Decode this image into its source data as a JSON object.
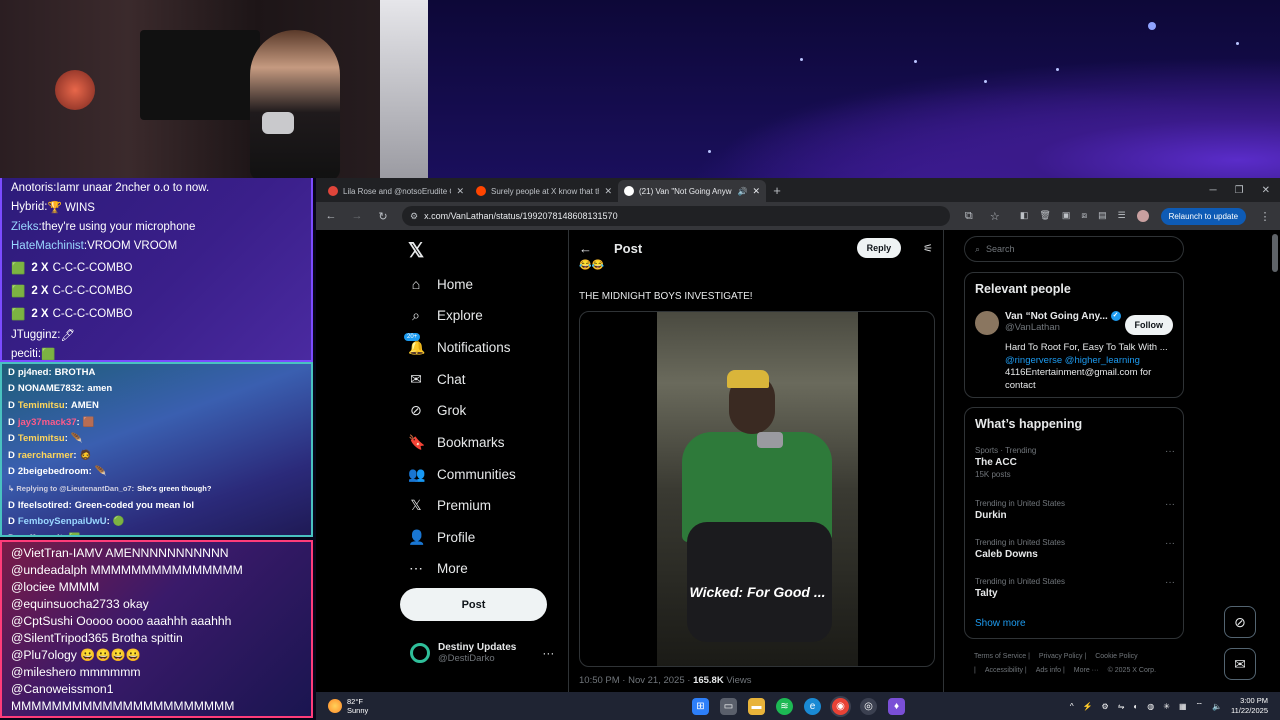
{
  "chat1": [
    {
      "user": "Anotoris",
      "msg": "Iamr unaar 2ncher o.o to now.",
      "color": "#ffffff",
      "partial": true
    },
    {
      "user": "Hybrid",
      "msg": "🏆 WINS",
      "color": "#ffffff"
    },
    {
      "user": "Zieks",
      "msg": "they're using your microphone",
      "color": "#9ad7ff"
    },
    {
      "user": "HateMachinist",
      "msg": "VROOM VROOM",
      "color": "#9ad7ff"
    },
    {
      "combo": "2 X",
      "text": "C-C-C-COMBO"
    },
    {
      "combo": "2 X",
      "text": "C-C-C-COMBO"
    },
    {
      "combo": "2 X",
      "text": "C-C-C-COMBO"
    },
    {
      "user": "JTugginz",
      "msg": "🖊",
      "color": "#ffffff"
    },
    {
      "user": "peciti",
      "msg": "🟩",
      "color": "#ffffff"
    }
  ],
  "chat2": [
    {
      "user": "pj4ned",
      "msg": "BROTHA",
      "color": "#ffffff"
    },
    {
      "user": "NONAME7832",
      "msg": "amen",
      "color": "#ffffff"
    },
    {
      "user": "Temimitsu",
      "msg": "AMEN",
      "color": "#ffd65a"
    },
    {
      "user": "jay37mack37",
      "msg": "🟫",
      "color": "#ff5a8a"
    },
    {
      "user": "Temimitsu",
      "msg": "🪶",
      "color": "#ffd65a"
    },
    {
      "user": "raercharmer",
      "msg": "🧔",
      "color": "#ffd65a"
    },
    {
      "user": "2beigebedroom",
      "msg": "🪶",
      "color": "#ffffff"
    },
    {
      "user": "↳ Replying to @LieutenantDan_o7:",
      "msg": "She's green though?",
      "color": "#d0d0e0",
      "small": true
    },
    {
      "user": "Ifeelsotired",
      "msg": "Green-coded you mean lol",
      "color": "#ffffff"
    },
    {
      "user": "FemboySenpaiUwU",
      "msg": "🟢",
      "color": "#9ad7ff"
    },
    {
      "user": "coffeespit",
      "msg": "🟩",
      "color": "#ffffff"
    }
  ],
  "chat3": [
    "@VietTran-IAMV AMENNNNNNNNNNN",
    "@undeadalph MMMMMMMMMMMMMMM",
    "@lociee MMMM",
    "@equinsuocha2733 okay",
    "@CptSushi Ooooo oooo aaahhh aaahhh",
    "@SilentTripod365 Brotha spittin",
    "@Plu7ology 😀😀😀😀",
    "@mileshero mmmmmm",
    "@Canoweissmon1",
    "MMMMMMMMMMMMMMMMMMMMMM"
  ],
  "tabs": [
    {
      "title": "Lila Rose and @notsoErudite C",
      "fav": "#e0453a"
    },
    {
      "title": "Surely people at X know that th",
      "fav": "#ff4500"
    },
    {
      "title": "(21) Van \"Not Going Anywh",
      "fav": "#ffffff",
      "active": true
    }
  ],
  "url": "x.com/VanLathan/status/1992078148608131570",
  "relaunch": "Relaunch to update",
  "nav": [
    {
      "icon": "⌂",
      "label": "Home",
      "name": "home-icon"
    },
    {
      "icon": "⌕",
      "label": "Explore",
      "name": "search-icon"
    },
    {
      "icon": "🔔",
      "label": "Notifications",
      "name": "bell-icon",
      "badge": "20+"
    },
    {
      "icon": "✉",
      "label": "Chat",
      "name": "mail-icon"
    },
    {
      "icon": "⊘",
      "label": "Grok",
      "name": "grok-icon"
    },
    {
      "icon": "🔖",
      "label": "Bookmarks",
      "name": "bookmark-icon"
    },
    {
      "icon": "👥",
      "label": "Communities",
      "name": "communities-icon"
    },
    {
      "icon": "𝕏",
      "label": "Premium",
      "name": "x-logo-icon"
    },
    {
      "icon": "👤",
      "label": "Profile",
      "name": "profile-icon"
    },
    {
      "icon": "⋯",
      "label": "More",
      "name": "more-circle-icon"
    }
  ],
  "post_button": "Post",
  "account": {
    "name": "Destiny Updates",
    "handle": "@DestiDarko"
  },
  "post": {
    "header": "Post",
    "reply": "Reply",
    "emoji": "😂😂",
    "text": "THE MIDNIGHT BOYS INVESTIGATE!",
    "caption": "Wicked: For Good ...",
    "time": "10:50 PM · Nov 21, 2025 · ",
    "views_count": "165.8K",
    "views_label": " Views"
  },
  "search_placeholder": "Search",
  "relevant": {
    "title": "Relevant people",
    "name": "Van “Not Going Any...",
    "handle": "@VanLathan",
    "follow": "Follow",
    "bio_line1": "Hard To Root For, Easy To Talk With ...",
    "bio_links": "@ringerverse @higher_learning",
    "bio_line3": "4116Entertainment@gmail.com for contact"
  },
  "happening": {
    "title": "What’s happening",
    "trends": [
      {
        "context": "Sports · Trending",
        "name": "The ACC",
        "count": "15K posts"
      },
      {
        "context": "Trending in United States",
        "name": "Durkin",
        "count": ""
      },
      {
        "context": "Trending in United States",
        "name": "Caleb Downs",
        "count": ""
      },
      {
        "context": "Trending in United States",
        "name": "Talty",
        "count": ""
      }
    ],
    "show_more": "Show more"
  },
  "footer": [
    "Terms of Service |",
    "Privacy Policy |",
    "Cookie Policy |",
    "Accessibility |",
    "Ads info |",
    "More ···",
    "© 2025 X Corp."
  ],
  "taskbar": {
    "temp": "82°F",
    "weather": "Sunny",
    "time": "3:00 PM",
    "date": "11/22/2025"
  }
}
